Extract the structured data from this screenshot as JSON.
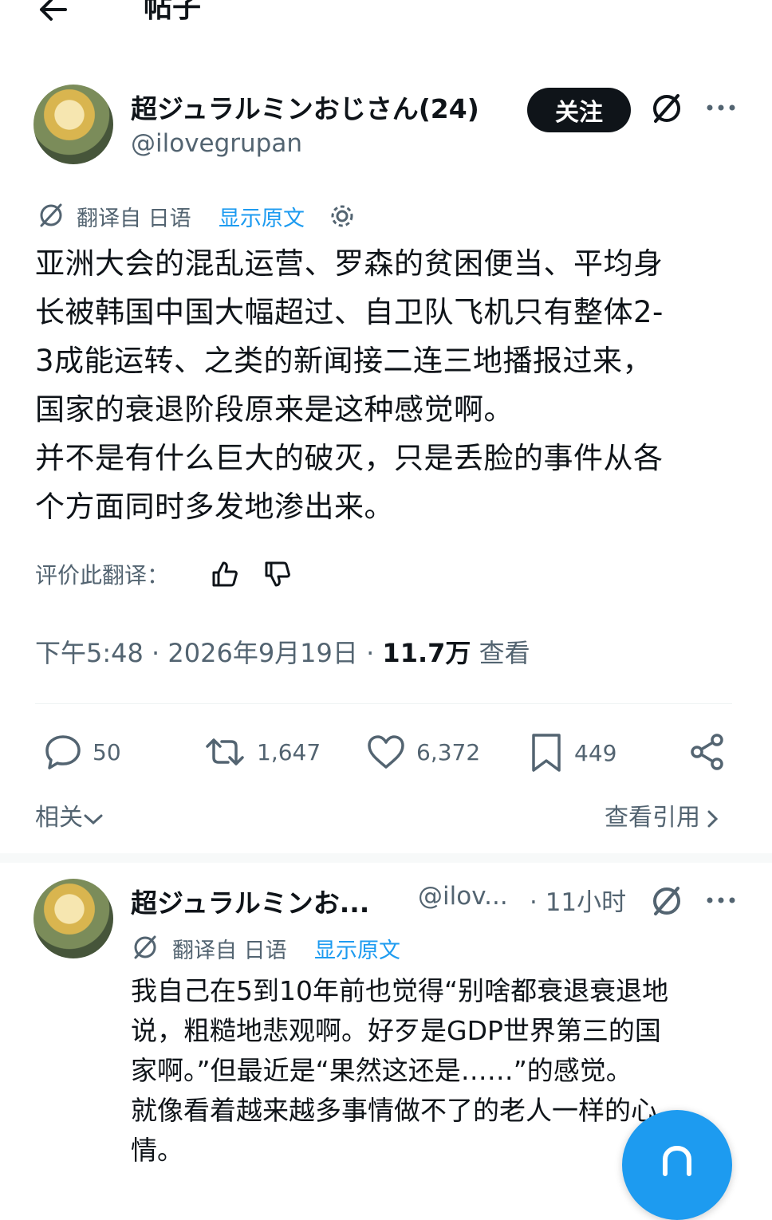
{
  "header": {
    "title": "帖子"
  },
  "post": {
    "author_name": "超ジュラルミンおじさん(24)",
    "author_handle": "@ilovegrupan",
    "follow_label": "关注",
    "translated_from": "翻译自 日语",
    "show_original": "显示原文",
    "text": "亚洲大会的混乱运营、罗森的贫困便当、平均身\n长被韩国中国大幅超过、自卫队飞机只有整体2-\n3成能运转、之类的新闻接二连三地播报过来，\n国家的衰退阶段原来是这种感觉啊。\n并不是有什么巨大的破灭，只是丢脸的事件从各\n个方面同时多发地渗出来。",
    "rate_label": "评价此翻译：",
    "time": "下午5:48 · 2026年9月19日 · ",
    "views": "11.7万",
    "views_label": " 查看",
    "stats": {
      "replies": "50",
      "retweets": "1,647",
      "likes": "6,372",
      "bookmarks": "449"
    },
    "related_label": "相关",
    "quotes_label": "查看引用"
  },
  "reply": {
    "author_name": "超ジュラルミンお...",
    "author_handle": "@ilov...",
    "time": "· 11小时",
    "translated_from": "翻译自 日语",
    "show_original": "显示原文",
    "text": "我自己在5到10年前也觉得“别啥都衰退衰退地\n说，粗糙地悲观啊。好歹是GDP世界第三的国\n家啊。”但最近是“果然这还是……”的感觉。\n就像看着越来越多事情做不了的老人一样的心\n情。"
  },
  "colors": {
    "accent": "#1d9bf0",
    "text": "#0f1419",
    "secondary": "#536471"
  }
}
